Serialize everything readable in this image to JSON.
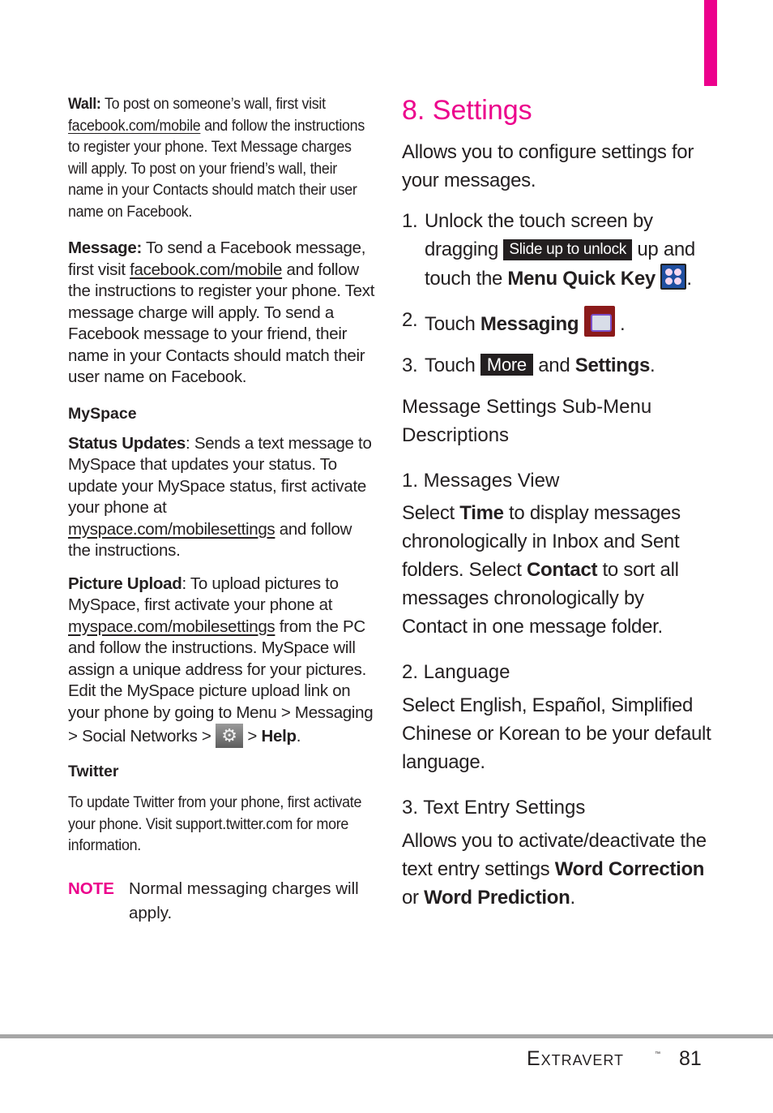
{
  "accent_color": "#ec008c",
  "left": {
    "wall": {
      "label": "Wall:",
      "text1": " To post on someone’s wall, first visit ",
      "link": "facebook.com/mobile",
      "text2": " and follow the instructions to register your phone. Text Message charges will apply. To post on your friend’s wall, their name in your Contacts should match their user name on Facebook."
    },
    "message": {
      "label": "Message:",
      "text1": " To send a Facebook message, first visit ",
      "link": "facebook.com/mobile",
      "text2": " and follow the instructions to register your phone. Text message charge will apply. To send a Facebook message to your friend, their name in your Contacts should match their user name on Facebook."
    },
    "myspace_heading": "MySpace",
    "status_updates": {
      "label": "Status Updates",
      "text1": ": Sends a text message to MySpace that updates your status. To update your MySpace status, first activate your phone at ",
      "link": "myspace.com/mobilesettings",
      "text2": " and follow the instructions."
    },
    "picture_upload": {
      "label": "Picture Upload",
      "text1": ": To upload pictures to MySpace, first activate your phone at ",
      "link": "myspace.com/mobilesettings",
      "text2": " from the PC and follow the instructions. MySpace will assign a unique address for your pictures. Edit the MySpace picture upload link on your phone by going to Menu > Messaging > Social Networks > ",
      "icon": "settings-gear-icon",
      "text3": " > ",
      "bold_end": "Help",
      "period": "."
    },
    "twitter_heading": "Twitter",
    "twitter_text": "To update Twitter from your phone, first activate your phone. Visit support.twitter.com for more information.",
    "note": {
      "label": "NOTE",
      "text": "Normal messaging charges will apply."
    }
  },
  "right": {
    "title": "8. Settings",
    "intro": "Allows you to configure settings for your messages.",
    "steps": [
      {
        "num": "1.",
        "t1": "Unlock the touch screen by dragging ",
        "chip": "Slide up to unlock",
        "t2": " up and touch the ",
        "bold": "Menu Quick Key",
        "icon": "menu-quick-key-icon",
        "end": "."
      },
      {
        "num": "2.",
        "t1": "Touch ",
        "bold": "Messaging",
        "icon": "messaging-icon",
        "end": "."
      },
      {
        "num": "3.",
        "t1": "Touch ",
        "chip": "More",
        "t2": " and ",
        "bold": "Settings",
        "end": "."
      }
    ],
    "submenu_heading": "Message Settings Sub-Menu Descriptions",
    "sections": [
      {
        "heading": "1. Messages View",
        "t1": "Select ",
        "b1": "Time",
        "t2": " to display messages chronologically in Inbox and Sent folders. Select ",
        "b2": "Contact",
        "t3": " to sort all messages chronologically by Contact in one message folder."
      },
      {
        "heading": "2. Language",
        "text": "Select English, Español, Simplified Chinese or Korean to be your default language."
      },
      {
        "heading": "3. Text Entry Settings",
        "t1": "Allows you to activate/deactivate the text entry settings ",
        "b1": "Word Correction",
        "t2": " or ",
        "b2": "Word Prediction",
        "t3": "."
      }
    ]
  },
  "footer": {
    "brand": "Extravert",
    "trademark": "™",
    "page_number": "81"
  }
}
